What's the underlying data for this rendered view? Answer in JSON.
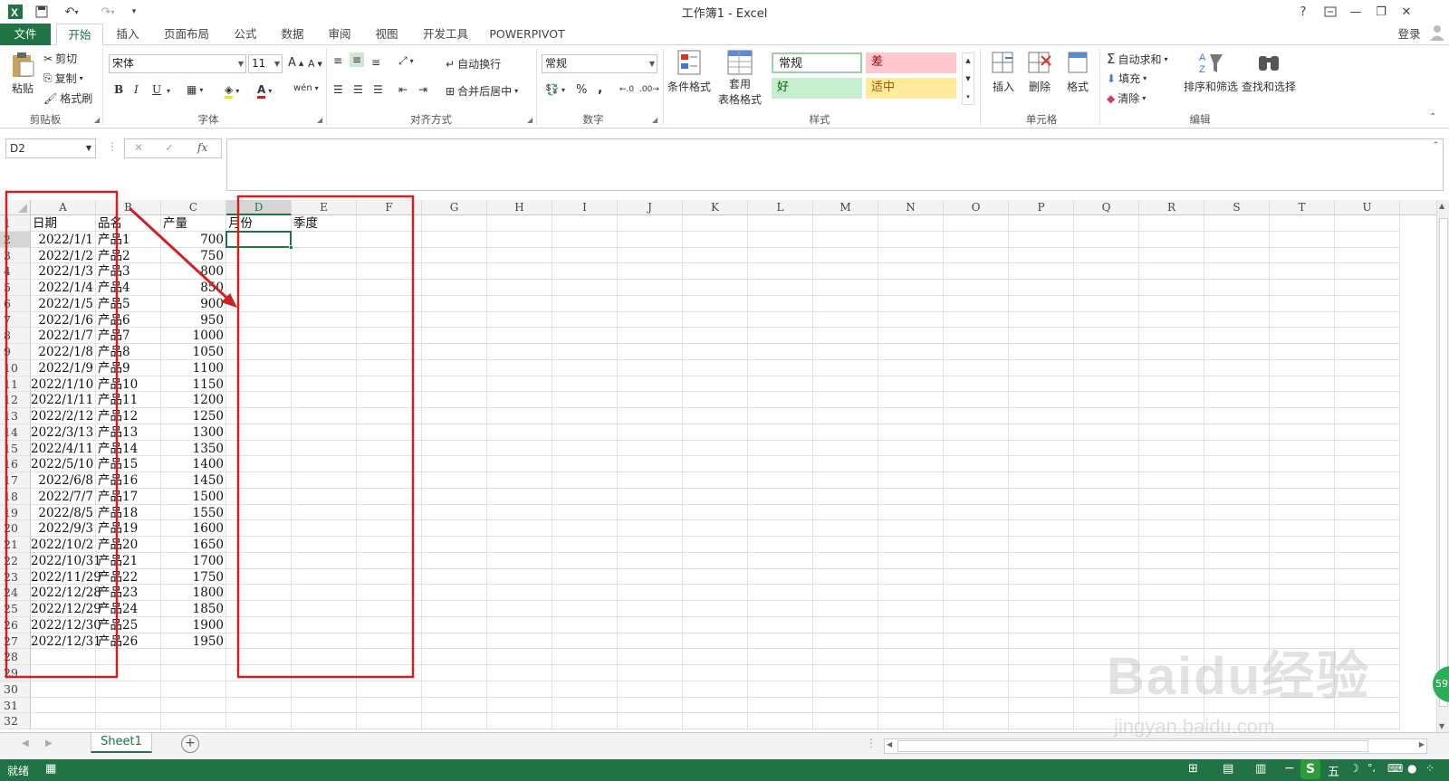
{
  "titlebar": {
    "title": "工作簿1 - Excel",
    "help": "?",
    "login": "登录"
  },
  "tabs": [
    "文件",
    "开始",
    "插入",
    "页面布局",
    "公式",
    "数据",
    "审阅",
    "视图",
    "开发工具",
    "POWERPIVOT"
  ],
  "ribbon": {
    "clipboard": {
      "paste": "粘贴",
      "cut": "剪切",
      "copy": "复制",
      "format_painter": "格式刷",
      "label": "剪贴板"
    },
    "font": {
      "name": "宋体",
      "size": "11",
      "bold": "B",
      "italic": "I",
      "underline": "U",
      "label": "字体"
    },
    "alignment": {
      "wrap": "自动换行",
      "merge": "合并后居中",
      "label": "对齐方式"
    },
    "number": {
      "format": "常规",
      "percent": "%",
      "comma": ",",
      "label": "数字"
    },
    "styles": {
      "conditional": "条件格式",
      "table_format_1": "套用",
      "table_format_2": "表格格式",
      "normal": "常规",
      "bad": "差",
      "good": "好",
      "neutral": "适中",
      "label": "样式"
    },
    "cells": {
      "insert": "插入",
      "delete": "删除",
      "format": "格式",
      "label": "单元格"
    },
    "editing": {
      "autosum": "自动求和",
      "fill": "填充",
      "clear": "清除",
      "sort": "排序和筛选",
      "find": "查找和选择",
      "label": "编辑"
    }
  },
  "formula_bar": {
    "name_box": "D2",
    "fx": "fx",
    "content": ""
  },
  "columns": [
    "A",
    "B",
    "C",
    "D",
    "E",
    "F",
    "G",
    "H",
    "I",
    "J",
    "K",
    "L",
    "M",
    "N",
    "O",
    "P",
    "Q",
    "R",
    "S",
    "T",
    "U"
  ],
  "row_numbers": [
    "1",
    "2",
    "3",
    "4",
    "5",
    "6",
    "7",
    "8",
    "9",
    "10",
    "11",
    "12",
    "13",
    "14",
    "15",
    "16",
    "17",
    "18",
    "19",
    "20",
    "21",
    "22",
    "23",
    "24",
    "25",
    "26",
    "27",
    "28",
    "29",
    "30",
    "31",
    "32"
  ],
  "headers": {
    "a": "日期",
    "b": "品名",
    "c": "产量",
    "d": "月份",
    "e": "季度"
  },
  "rows": [
    [
      "2022/1/1",
      "产品1",
      "700"
    ],
    [
      "2022/1/2",
      "产品2",
      "750"
    ],
    [
      "2022/1/3",
      "产品3",
      "800"
    ],
    [
      "2022/1/4",
      "产品4",
      "850"
    ],
    [
      "2022/1/5",
      "产品5",
      "900"
    ],
    [
      "2022/1/6",
      "产品6",
      "950"
    ],
    [
      "2022/1/7",
      "产品7",
      "1000"
    ],
    [
      "2022/1/8",
      "产品8",
      "1050"
    ],
    [
      "2022/1/9",
      "产品9",
      "1100"
    ],
    [
      "2022/1/10",
      "产品10",
      "1150"
    ],
    [
      "2022/1/11",
      "产品11",
      "1200"
    ],
    [
      "2022/2/12",
      "产品12",
      "1250"
    ],
    [
      "2022/3/13",
      "产品13",
      "1300"
    ],
    [
      "2022/4/11",
      "产品14",
      "1350"
    ],
    [
      "2022/5/10",
      "产品15",
      "1400"
    ],
    [
      "2022/6/8",
      "产品16",
      "1450"
    ],
    [
      "2022/7/7",
      "产品17",
      "1500"
    ],
    [
      "2022/8/5",
      "产品18",
      "1550"
    ],
    [
      "2022/9/3",
      "产品19",
      "1600"
    ],
    [
      "2022/10/2",
      "产品20",
      "1650"
    ],
    [
      "2022/10/31",
      "产品21",
      "1700"
    ],
    [
      "2022/11/29",
      "产品22",
      "1750"
    ],
    [
      "2022/12/28",
      "产品23",
      "1800"
    ],
    [
      "2022/12/29",
      "产品24",
      "1850"
    ],
    [
      "2022/12/30",
      "产品25",
      "1900"
    ],
    [
      "2022/12/31",
      "产品26",
      "1950"
    ]
  ],
  "sheet_tabs": [
    "Sheet1"
  ],
  "status": {
    "ready": "就绪",
    "ime": "五"
  },
  "watermark": {
    "brand": "Baidu经验",
    "url": "jingyan.baidu.com"
  },
  "colors": {
    "accent": "#217346",
    "annotation": "#cc2222"
  }
}
